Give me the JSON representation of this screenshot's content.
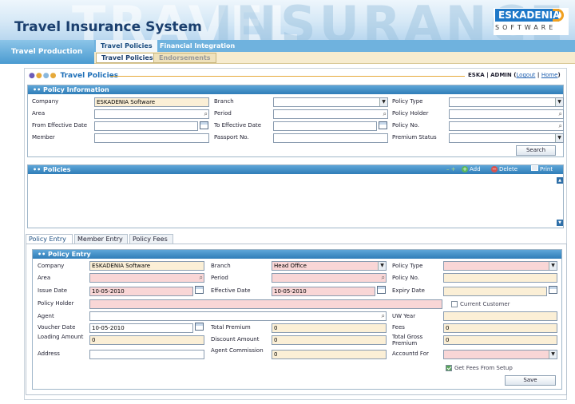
{
  "app": {
    "title": "Travel Insurance System",
    "watermark_left": "TRAVEL",
    "watermark_right": "INSURANCE",
    "logo_brand": "ESKADENIA",
    "logo_sub": "SOFTWARE"
  },
  "sidebar": {
    "item": "Travel Production"
  },
  "top_tabs": [
    "Travel Policies",
    "Financial Integration"
  ],
  "sub_tabs": [
    "Travel Policies",
    "Endorsements"
  ],
  "page": {
    "title": "Travel Policies",
    "user": "ESKA | ADMIN",
    "logout": "Logout",
    "separator": "|",
    "home": "Home"
  },
  "policy_info": {
    "header": "Policy Information",
    "labels": {
      "company": "Company",
      "branch": "Branch",
      "policy_type": "Policy Type",
      "area": "Area",
      "period": "Period",
      "policy_holder": "Policy Holder",
      "from_effective_date": "From Effective Date",
      "to_effective_date": "To Effective Date",
      "policy_no": "Policy No.",
      "member": "Member",
      "passport_no": "Passport No.",
      "premium_status": "Premium Status"
    },
    "values": {
      "company": "ESKADENIA Software"
    },
    "search_button": "Search"
  },
  "policies": {
    "header": "Policies",
    "add": "Add",
    "delete": "Delete",
    "print": "Print"
  },
  "tabs": [
    "Policy Entry",
    "Member Entry",
    "Policy Fees"
  ],
  "policy_entry": {
    "header": "Policy Entry",
    "labels": {
      "company": "Company",
      "branch": "Branch",
      "policy_type": "Policy Type",
      "area": "Area",
      "period": "Period",
      "policy_no": "Policy No.",
      "issue_date": "Issue Date",
      "effective_date": "Effective Date",
      "expiry_date": "Expiry Date",
      "policy_holder": "Policy Holder",
      "current_customer": "Current Customer",
      "agent": "Agent",
      "uw_year": "UW Year",
      "voucher_date": "Voucher Date",
      "total_premium": "Total Premium",
      "fees": "Fees",
      "loading_amount": "Loading Amount",
      "discount_amount": "Discount Amount",
      "total_gross_premium": "Total Gross Premium",
      "address": "Address",
      "agent_commission": "Agent Commission",
      "account_for": "Accountd For",
      "get_fees": "Get Fees From Setup"
    },
    "values": {
      "company": "ESKADENIA Software",
      "branch": "Head Office",
      "issue_date": "10-05-2010",
      "effective_date": "10-05-2010",
      "voucher_date": "10-05-2010",
      "total_premium": "0",
      "fees": "0",
      "loading_amount": "0",
      "discount_amount": "0",
      "total_gross_premium": "0",
      "agent_commission": "0"
    },
    "save_button": "Save"
  },
  "colors": {
    "header_blue": "#2f7db8",
    "beige_field": "#fbefd6",
    "pink_required": "#f9d6d6",
    "accent_orange": "#e6a93a"
  }
}
